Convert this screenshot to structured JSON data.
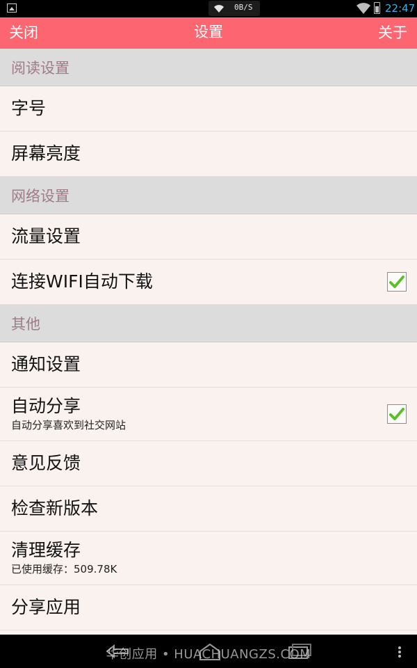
{
  "status_bar": {
    "speed": "0B/S",
    "time": "22:47",
    "icons": [
      "image-notification-icon",
      "wifi-icon",
      "battery-icon"
    ]
  },
  "title_bar": {
    "left_button": "关闭",
    "title": "设置",
    "right_button": "关于",
    "color": "#fd6671"
  },
  "sections": {
    "reading": {
      "header": "阅读设置",
      "font_size": "字号",
      "brightness": "屏幕亮度"
    },
    "network": {
      "header": "网络设置",
      "traffic": "流量设置",
      "wifi_download": "连接WIFI自动下载",
      "wifi_download_checked": true
    },
    "other": {
      "header": "其他",
      "notification": "通知设置",
      "auto_share": "自动分享",
      "auto_share_desc": "自动分享喜欢到社交网站",
      "auto_share_checked": true,
      "feedback": "意见反馈",
      "check_update": "检查新版本",
      "clear_cache": "清理缓存",
      "cache_info": "已使用缓存：509.78K",
      "share_app": "分享应用"
    }
  },
  "nav_bar": {
    "watermark": "华创应用 • HUACHUANGZS.COM",
    "icons": [
      "back-icon",
      "home-icon",
      "recent-apps-icon",
      "menu-icon"
    ]
  },
  "colors": {
    "accent": "#fd6671",
    "check": "#5cbf2a",
    "section_text": "#9e7b86"
  }
}
